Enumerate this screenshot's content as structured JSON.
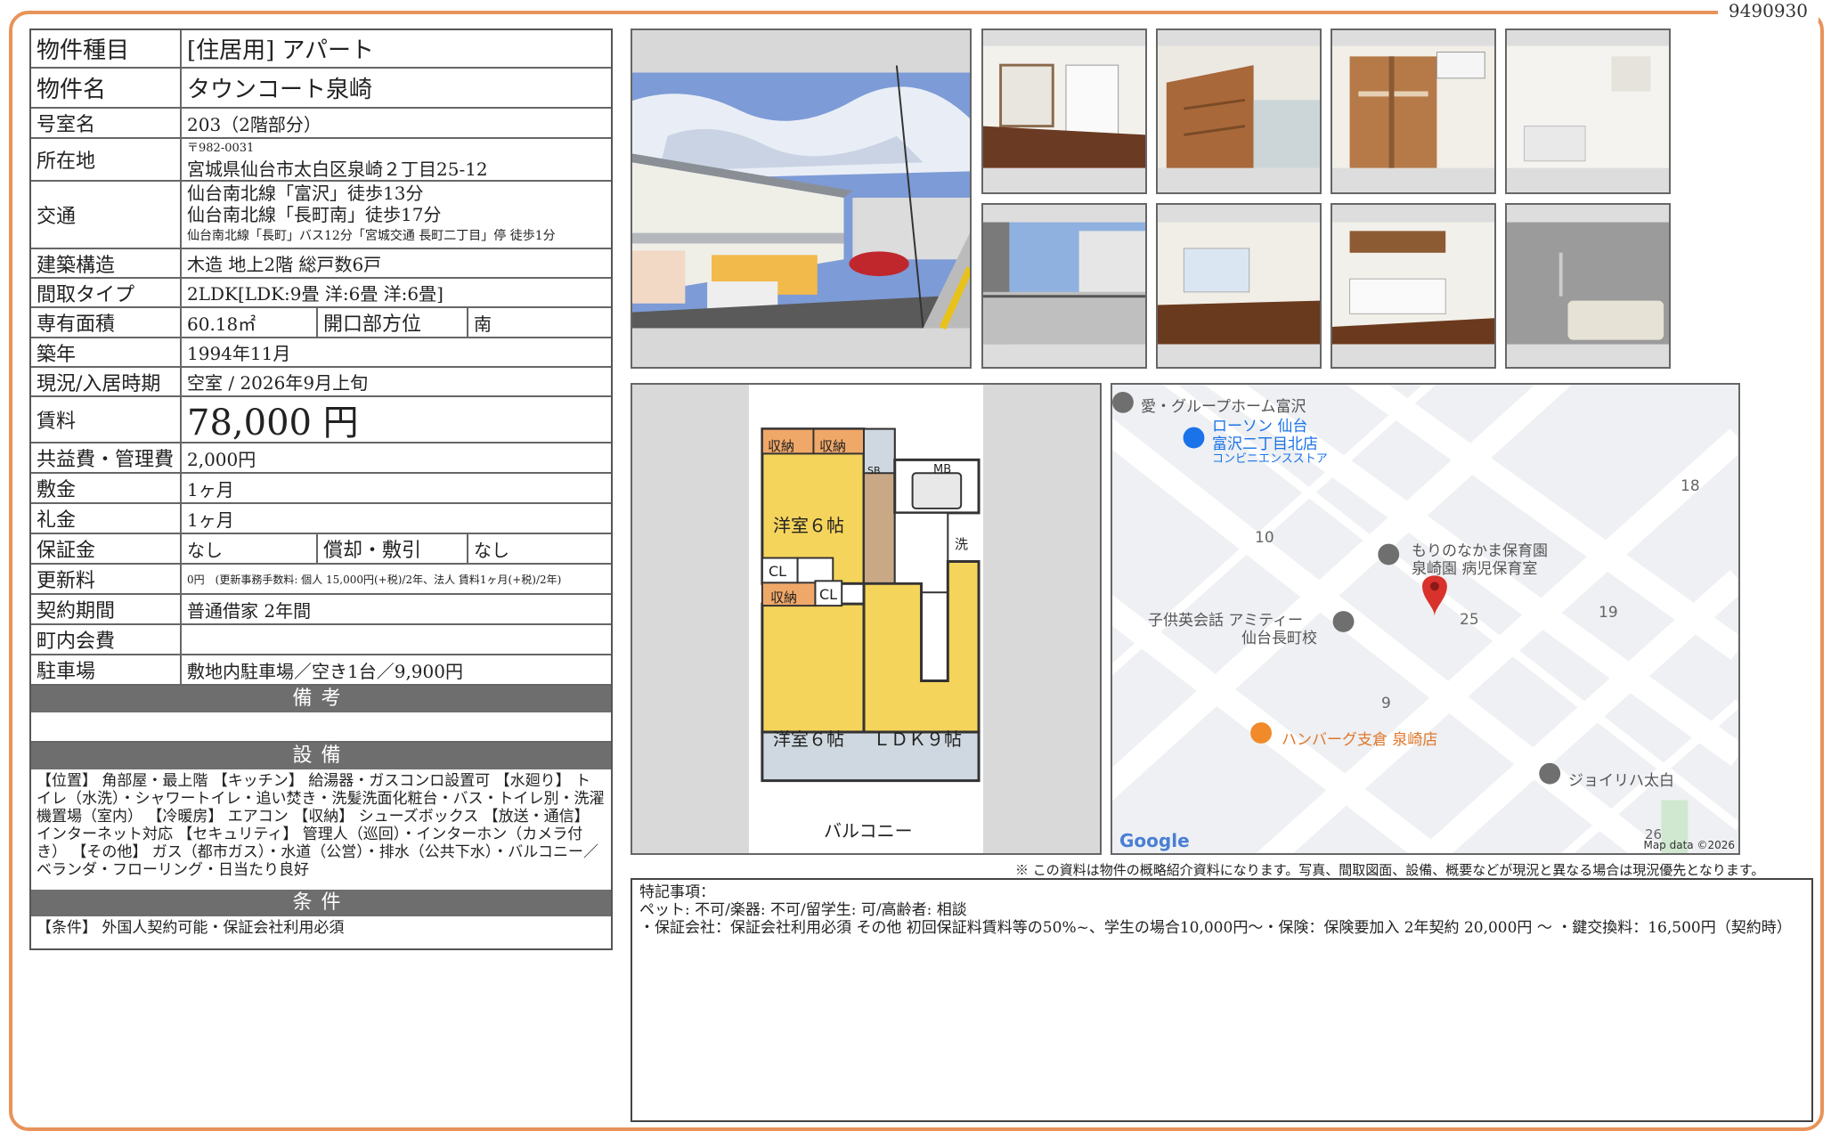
{
  "doc_id": "9490930",
  "fields": {
    "type": {
      "label": "物件種目",
      "value": "[住居用]  アパート"
    },
    "name": {
      "label": "物件名",
      "value": "タウンコート泉崎"
    },
    "room": {
      "label": "号室名",
      "value": "203（2階部分）"
    },
    "address": {
      "label": "所在地",
      "postal": "〒982-0031",
      "value": "宮城県仙台市太白区泉崎２丁目25-12"
    },
    "access": {
      "label": "交通",
      "line1": "仙台南北線「富沢」徒歩13分",
      "line2": "仙台南北線「長町南」徒歩17分",
      "line3": "仙台南北線「長町」バス12分「宮城交通 長町二丁目」停 徒歩1分"
    },
    "structure": {
      "label": "建築構造",
      "value": "木造 地上2階 総戸数6戸"
    },
    "layout": {
      "label": "間取タイプ",
      "value": "2LDK[LDK:9畳 洋:6畳 洋:6畳]"
    },
    "area": {
      "label": "専有面積",
      "value": "60.18㎡",
      "label2": "開口部方位",
      "value2": "南"
    },
    "built": {
      "label": "築年",
      "value": "1994年11月"
    },
    "status": {
      "label": "現況/入居時期",
      "value": "空室  /  2026年9月上旬"
    },
    "rent": {
      "label": "賃料",
      "value": "78,000 円"
    },
    "common": {
      "label": "共益費・管理費",
      "value": "2,000円"
    },
    "deposit": {
      "label": "敷金",
      "value": "1ヶ月"
    },
    "key_money": {
      "label": "礼金",
      "value": "1ヶ月"
    },
    "guarantee": {
      "label": "保証金",
      "value": "なし",
      "label2": "償却・敷引",
      "value2": "なし"
    },
    "renewal": {
      "label": "更新料",
      "value": "0円　(更新事務手数料: 個人 15,000円(+税)/2年、法人 賃料1ヶ月(+税)/2年)"
    },
    "contract": {
      "label": "契約期間",
      "value": "普通借家 2年間"
    },
    "community": {
      "label": "町内会費",
      "value": ""
    },
    "parking": {
      "label": "駐車場",
      "value": "敷地内駐車場／空き1台／9,900円"
    }
  },
  "sections": {
    "remarks": "備考",
    "equipment": "設備",
    "conditions": "条件"
  },
  "equipment_text": "【位置】 角部屋・最上階 【キッチン】 給湯器・ガスコンロ設置可 【水廻り】 トイレ（水洗）・シャワートイレ・追い焚き・洗髪洗面化粧台・バス・トイレ別・洗濯機置場（室内） 【冷暖房】 エアコン 【収納】 シューズボックス 【放送・通信】 インターネット対応 【セキュリティ】 管理人（巡回）・インターホン（カメラ付き） 【その他】 ガス（都市ガス）・水道（公営）・排水（公共下水）・バルコニー／ベランダ・フローリング・日当たり良好",
  "conditions_text": "【条件】 外国人契約可能・保証会社利用必須",
  "floorplan": {
    "room1": "洋室６帖",
    "room2": "洋室６帖",
    "ldk": "ＬＤＫ９帖",
    "balcony": "バルコニー",
    "storage1": "収納",
    "storage2": "収納",
    "storage3": "収納",
    "cl1": "CL",
    "cl2": "CL",
    "mb": "MB",
    "wash": "洗",
    "sb": "SB"
  },
  "map": {
    "labels": [
      "愛・グループホーム富沢",
      "ローソン 仙台",
      "富沢二丁目北店",
      "コンビニエンスストア",
      "もりのなかま保育園",
      "泉崎園 病児保育室",
      "子供英会話 アミティー",
      "仙台長町校",
      "ハンバーグ支倉 泉崎店",
      "ジョイリハ太白"
    ],
    "numbers": [
      "18",
      "10",
      "19",
      "25",
      "9",
      "26"
    ],
    "google": "Google",
    "credit": "Map data ©2026"
  },
  "disclaimer": "※ この資料は物件の概略紹介資料になります。写真、間取図面、設備、概要などが現況と異なる場合は現況優先となります。",
  "special": {
    "title": "特記事項：",
    "line1": "ペット: 不可/楽器: 不可/留学生: 可/高齢者: 相談",
    "line2": "・保証会社：保証会社利用必須 その他 初回保証料賃料等の50%~、学生の場合10,000円～・保険：保険要加入 2年契約 20,000円 ～ ・鍵交換料：16,500円（契約時）"
  },
  "colors": {
    "frame": "#e8935a",
    "section_bg": "#6e6e6e",
    "pin": "#d9312b",
    "plan_yellow": "#f5d45b",
    "plan_orange": "#f0a868"
  }
}
